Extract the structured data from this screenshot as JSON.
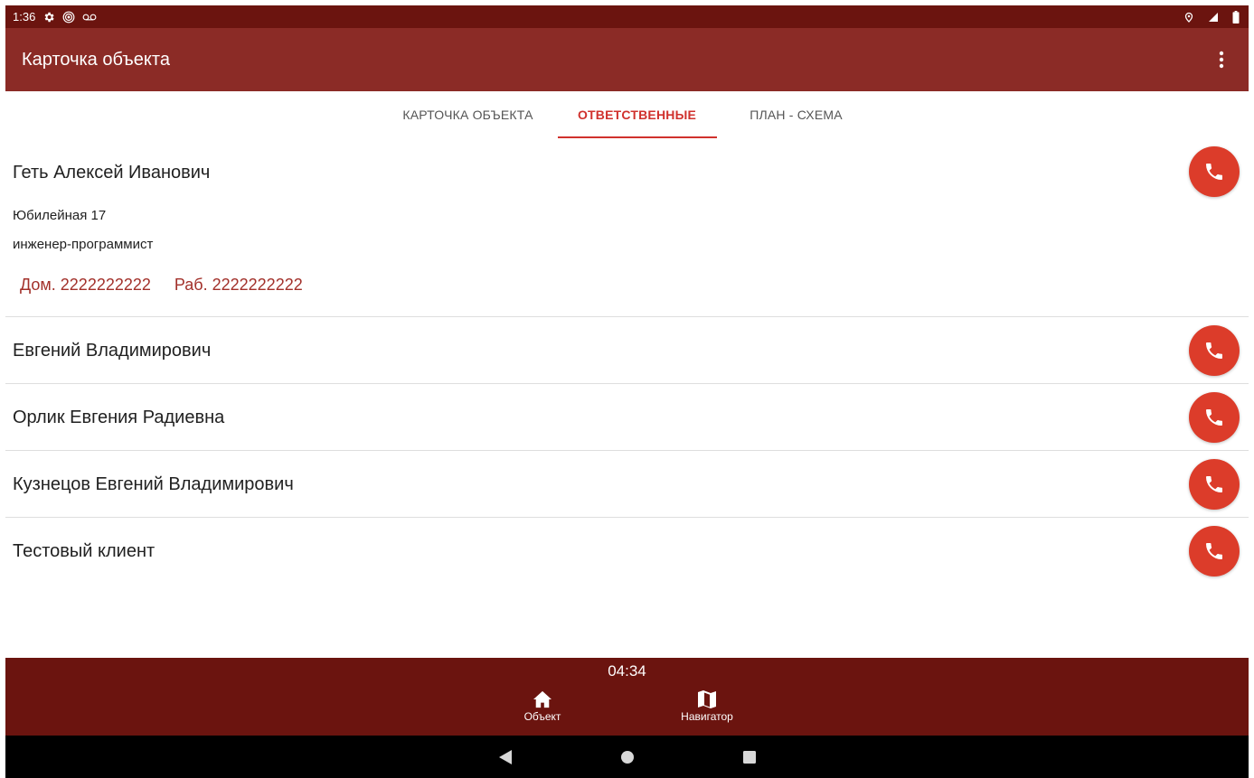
{
  "status_bar": {
    "time": "1:36",
    "icons": [
      "gear-icon",
      "hotspot-icon",
      "voicemail-icon",
      "location-icon",
      "signal-icon",
      "battery-icon"
    ]
  },
  "app_bar": {
    "title": "Карточка объекта",
    "menu_icon": "more-vert-icon"
  },
  "tabs": [
    {
      "label": "КАРТОЧКА ОБЪЕКТА",
      "active": false
    },
    {
      "label": "ОТВЕТСТВЕННЫЕ",
      "active": true
    },
    {
      "label": "ПЛАН - СХЕМА",
      "active": false
    }
  ],
  "contacts": [
    {
      "name": "Геть Алексей Иванович",
      "address": "Юбилейная 17",
      "position": "инженер-программист",
      "home_phone": "Дом. 2222222222",
      "work_phone": "Раб. 2222222222"
    },
    {
      "name": "Евгений Владимирович"
    },
    {
      "name": "Орлик Евгения Радиевна"
    },
    {
      "name": "Кузнецов Евгений Владимирович"
    },
    {
      "name": "Тестовый клиент"
    }
  ],
  "bottom_nav": {
    "timer": "04:34",
    "items": [
      {
        "label": "Объект",
        "icon": "home-icon"
      },
      {
        "label": "Навигатор",
        "icon": "map-icon"
      }
    ]
  },
  "colors": {
    "status_bar": "#6b140f",
    "app_bar": "#8b2b26",
    "accent": "#d0312d",
    "call_button": "#dc3c2a",
    "phone_text": "#a2302a"
  }
}
